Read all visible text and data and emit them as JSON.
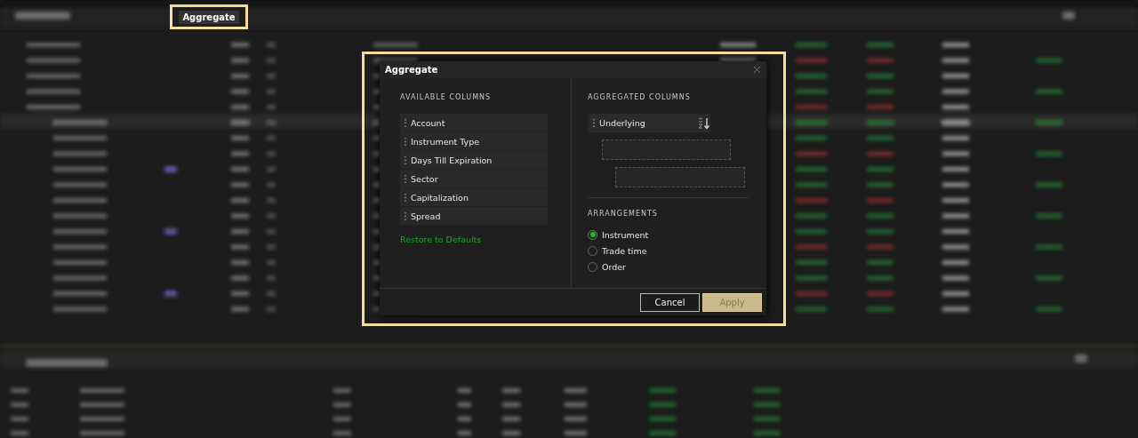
{
  "toolbar": {
    "aggregate_button": "Aggregate"
  },
  "dialog": {
    "title": "Aggregate",
    "available": {
      "heading": "AVAILABLE COLUMNS",
      "items": [
        {
          "label": "Account"
        },
        {
          "label": "Instrument Type"
        },
        {
          "label": "Days Till Expiration"
        },
        {
          "label": "Sector"
        },
        {
          "label": "Capitalization"
        },
        {
          "label": "Spread"
        }
      ],
      "restore_link": "Restore to Defaults"
    },
    "aggregated": {
      "heading": "AGGREGATED COLUMNS",
      "items": [
        {
          "label": "Underlying"
        }
      ]
    },
    "arrangements": {
      "heading": "ARRANGEMENTS",
      "options": [
        {
          "label": "Instrument",
          "selected": true
        },
        {
          "label": "Trade time",
          "selected": false
        },
        {
          "label": "Order",
          "selected": false
        }
      ]
    },
    "buttons": [
      {
        "label": "Cancel",
        "kind": "secondary"
      },
      {
        "label": "Apply",
        "kind": "primary"
      }
    ]
  }
}
